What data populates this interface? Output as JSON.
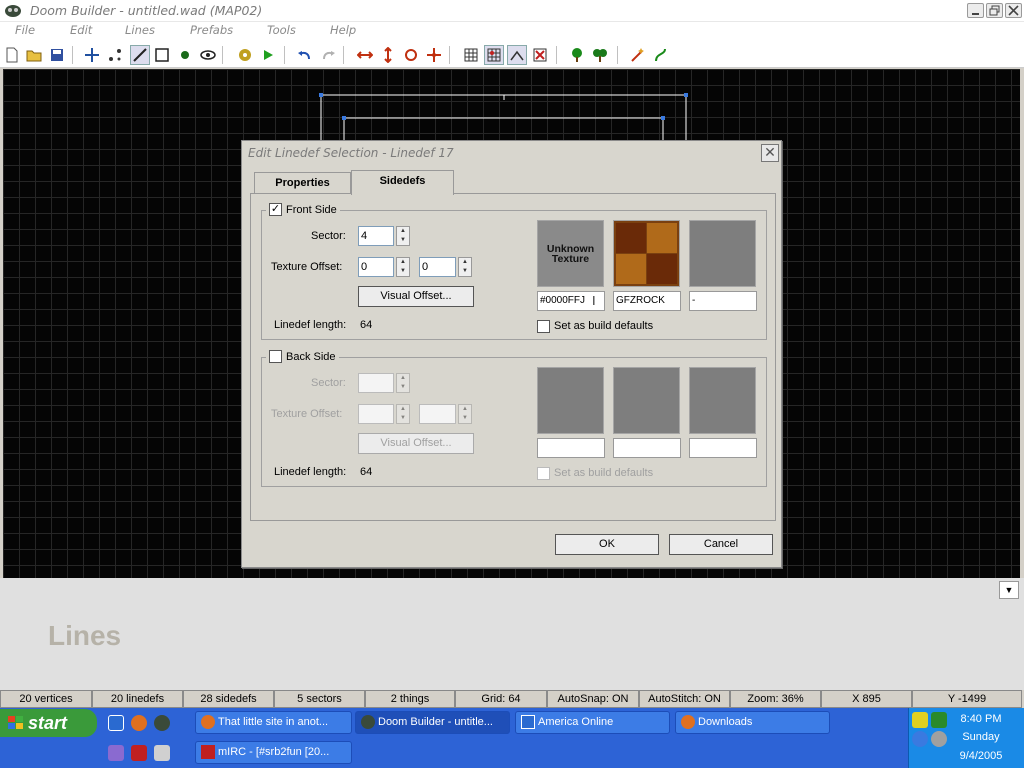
{
  "window": {
    "title": "Doom Builder - untitled.wad (MAP02)"
  },
  "menu": [
    "File",
    "Edit",
    "Lines",
    "Prefabs",
    "Tools",
    "Help"
  ],
  "toolbar": {
    "icons": [
      "new-file-icon",
      "open-folder-icon",
      "save-icon",
      "move-icon",
      "vertices-mode-icon",
      "lines-mode-icon",
      "sectors-mode-icon",
      "things-mode-icon",
      "3d-mode-icon",
      "build-icon",
      "test-play-icon",
      "undo-icon",
      "redo-icon",
      "flip-horizontal-icon",
      "flip-vertical-icon",
      "rotate-icon",
      "resize-icon",
      "grid-icon",
      "snap-grid-icon",
      "stitch-icon",
      "delete-icon",
      "tree-icon",
      "trees-icon",
      "wand-icon",
      "script-icon"
    ]
  },
  "mode_label": "Lines",
  "statusbar": {
    "cells": [
      "20 vertices",
      "20 linedefs",
      "28 sidedefs",
      "5 sectors",
      "2 things",
      "Grid: 64",
      "AutoSnap: ON",
      "AutoStitch: ON",
      "Zoom: 36%",
      "X 895",
      "Y -1499"
    ]
  },
  "dialog": {
    "title": "Edit Linedef Selection - Linedef 17",
    "tabs": [
      "Properties",
      "Sidedefs"
    ],
    "active_tab": "Sidedefs",
    "front": {
      "label": "Front Side",
      "checked": true,
      "check_mark": "✓",
      "sector_label": "Sector:",
      "sector_value": "4",
      "offset_label": "Texture Offset:",
      "offset_x": "0",
      "offset_y": "0",
      "visual_button": "Visual Offset...",
      "length_label": "Linedef length:",
      "length_value": "64",
      "textures": [
        "#0000FFJ",
        "GFZROCK",
        "-"
      ],
      "unknown_texture_text": "Unknown Texture",
      "build_defaults": "Set as build defaults"
    },
    "back": {
      "label": "Back Side",
      "checked": false,
      "sector_label": "Sector:",
      "offset_label": "Texture Offset:",
      "visual_button": "Visual Offset...",
      "length_label": "Linedef length:",
      "length_value": "64",
      "build_defaults": "Set as build defaults"
    },
    "ok": "OK",
    "cancel": "Cancel"
  },
  "taskbar": {
    "start": "start",
    "tasks": [
      "That little site in anot...",
      "Doom Builder - untitle...",
      "America  Online",
      "Downloads",
      "mIRC - [#srb2fun [20..."
    ],
    "active_task": "Doom Builder - untitle...",
    "clock": {
      "time": "8:40 PM",
      "day": "Sunday",
      "date": "9/4/2005"
    }
  }
}
